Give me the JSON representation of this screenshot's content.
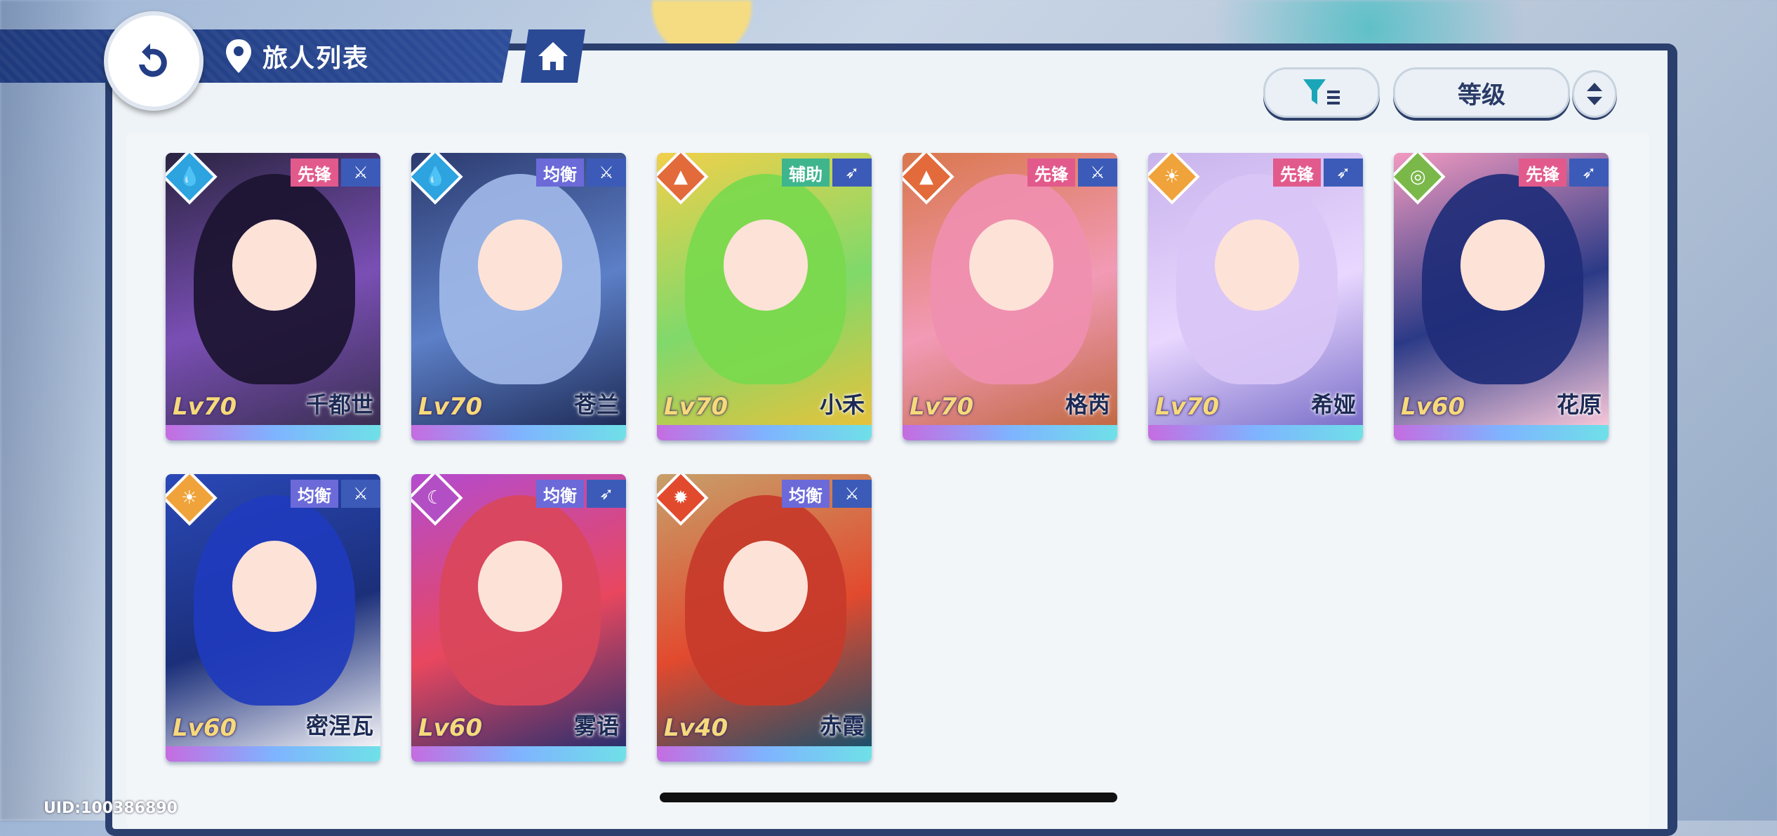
{
  "header": {
    "title": "旅人列表"
  },
  "toolbar": {
    "sort_label": "等级"
  },
  "characters": [
    {
      "name": "千都世",
      "level": "Lv70",
      "role": "先锋",
      "element": "water",
      "weapon": "sword",
      "color": "#2da3e0",
      "role_color": "#e25a8c"
    },
    {
      "name": "苍兰",
      "level": "Lv70",
      "role": "均衡",
      "element": "water",
      "weapon": "sword",
      "color": "#2da3e0",
      "role_color": "#6b6ad8"
    },
    {
      "name": "小禾",
      "level": "Lv70",
      "role": "辅助",
      "element": "earth",
      "weapon": "bow",
      "color": "#e36a3a",
      "role_color": "#3fb58e"
    },
    {
      "name": "格芮",
      "level": "Lv70",
      "role": "先锋",
      "element": "earth",
      "weapon": "sword",
      "color": "#e36a3a",
      "role_color": "#e25a8c"
    },
    {
      "name": "希娅",
      "level": "Lv70",
      "role": "先锋",
      "element": "light",
      "weapon": "bow",
      "color": "#f0a33a",
      "role_color": "#e25a8c"
    },
    {
      "name": "花原",
      "level": "Lv60",
      "role": "先锋",
      "element": "wind",
      "weapon": "bow",
      "color": "#7ab84a",
      "role_color": "#e25a8c"
    },
    {
      "name": "密涅瓦",
      "level": "Lv60",
      "role": "均衡",
      "element": "light",
      "weapon": "sword",
      "color": "#f0a33a",
      "role_color": "#6b6ad8"
    },
    {
      "name": "雾语",
      "level": "Lv60",
      "role": "均衡",
      "element": "dark",
      "weapon": "bow",
      "color": "#b34fc4",
      "role_color": "#6b6ad8"
    },
    {
      "name": "赤霞",
      "level": "Lv40",
      "role": "均衡",
      "element": "fire",
      "weapon": "sword",
      "color": "#e24a2e",
      "role_color": "#6b6ad8"
    }
  ],
  "footer": {
    "uid": "UID:100386890"
  }
}
